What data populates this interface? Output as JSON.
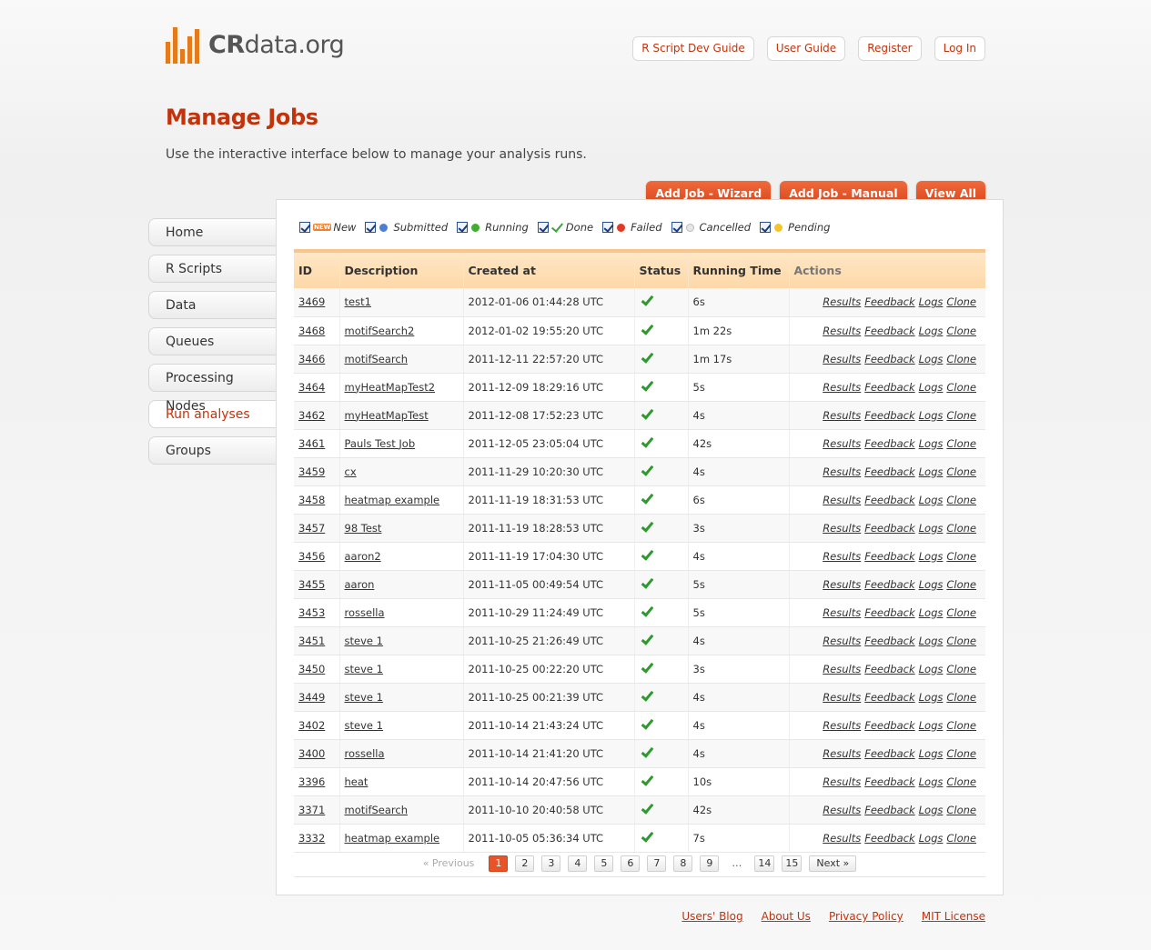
{
  "logo": {
    "brand": "CR",
    "rest": "data.org"
  },
  "topnav": [
    "R Script Dev Guide",
    "User Guide",
    "Register",
    "Log In"
  ],
  "page": {
    "title": "Manage Jobs",
    "subtitle": "Use the interactive interface below to manage your analysis runs."
  },
  "action_buttons": [
    "Add Job - Wizard",
    "Add Job - Manual",
    "View All"
  ],
  "sidebar": [
    {
      "label": "Home",
      "active": false
    },
    {
      "label": "R Scripts",
      "active": false
    },
    {
      "label": "Data",
      "active": false
    },
    {
      "label": "Queues",
      "active": false
    },
    {
      "label": "Processing Nodes",
      "active": false
    },
    {
      "label": "Run analyses",
      "active": true
    },
    {
      "label": "Groups",
      "active": false
    }
  ],
  "legend": [
    {
      "label": "New",
      "icon": "new-badge-icon",
      "color": "#f08030"
    },
    {
      "label": "Submitted",
      "icon": "blue-dot-icon",
      "color": "#4d7fd0"
    },
    {
      "label": "Running",
      "icon": "green-dot-icon",
      "color": "#3fae2f"
    },
    {
      "label": "Done",
      "icon": "green-check-icon",
      "color": "#3aa33a"
    },
    {
      "label": "Failed",
      "icon": "red-dot-icon",
      "color": "#e23a22"
    },
    {
      "label": "Cancelled",
      "icon": "grey-dot-icon",
      "color": "#e6e6e6"
    },
    {
      "label": "Pending",
      "icon": "yellow-dot-icon",
      "color": "#f4c52a"
    }
  ],
  "table": {
    "headers": [
      "ID",
      "Description",
      "Created at",
      "Status",
      "Running Time",
      "Actions"
    ],
    "action_links": [
      "Results",
      "Feedback",
      "Logs",
      "Clone"
    ],
    "rows": [
      {
        "id": "3469",
        "desc": "test1",
        "created": "2012-01-06 01:44:28 UTC",
        "status": "done",
        "time": "6s"
      },
      {
        "id": "3468",
        "desc": "motifSearch2",
        "created": "2012-01-02 19:55:20 UTC",
        "status": "done",
        "time": "1m 22s"
      },
      {
        "id": "3466",
        "desc": "motifSearch",
        "created": "2011-12-11 22:57:20 UTC",
        "status": "done",
        "time": "1m 17s"
      },
      {
        "id": "3464",
        "desc": "myHeatMapTest2",
        "created": "2011-12-09 18:29:16 UTC",
        "status": "done",
        "time": "5s"
      },
      {
        "id": "3462",
        "desc": "myHeatMapTest",
        "created": "2011-12-08 17:52:23 UTC",
        "status": "done",
        "time": "4s"
      },
      {
        "id": "3461",
        "desc": "Pauls Test Job",
        "created": "2011-12-05 23:05:04 UTC",
        "status": "done",
        "time": "42s"
      },
      {
        "id": "3459",
        "desc": "cx",
        "created": "2011-11-29 10:20:30 UTC",
        "status": "done",
        "time": "4s"
      },
      {
        "id": "3458",
        "desc": "heatmap example",
        "created": "2011-11-19 18:31:53 UTC",
        "status": "done",
        "time": "6s"
      },
      {
        "id": "3457",
        "desc": "98 Test",
        "created": "2011-11-19 18:28:53 UTC",
        "status": "done",
        "time": "3s"
      },
      {
        "id": "3456",
        "desc": "aaron2",
        "created": "2011-11-19 17:04:30 UTC",
        "status": "done",
        "time": "4s"
      },
      {
        "id": "3455",
        "desc": "aaron",
        "created": "2011-11-05 00:49:54 UTC",
        "status": "done",
        "time": "5s"
      },
      {
        "id": "3453",
        "desc": "rossella",
        "created": "2011-10-29 11:24:49 UTC",
        "status": "done",
        "time": "5s"
      },
      {
        "id": "3451",
        "desc": "steve 1",
        "created": "2011-10-25 21:26:49 UTC",
        "status": "done",
        "time": "4s"
      },
      {
        "id": "3450",
        "desc": "steve 1",
        "created": "2011-10-25 00:22:20 UTC",
        "status": "done",
        "time": "3s"
      },
      {
        "id": "3449",
        "desc": "steve 1",
        "created": "2011-10-25 00:21:39 UTC",
        "status": "done",
        "time": "4s"
      },
      {
        "id": "3402",
        "desc": "steve 1",
        "created": "2011-10-14 21:43:24 UTC",
        "status": "done",
        "time": "4s"
      },
      {
        "id": "3400",
        "desc": "rossella",
        "created": "2011-10-14 21:41:20 UTC",
        "status": "done",
        "time": "4s"
      },
      {
        "id": "3396",
        "desc": "heat",
        "created": "2011-10-14 20:47:56 UTC",
        "status": "done",
        "time": "10s"
      },
      {
        "id": "3371",
        "desc": "motifSearch",
        "created": "2011-10-10 20:40:58 UTC",
        "status": "done",
        "time": "42s"
      },
      {
        "id": "3332",
        "desc": "heatmap example",
        "created": "2011-10-05 05:36:34 UTC",
        "status": "done",
        "time": "7s"
      }
    ]
  },
  "pagination": {
    "previous": "« Previous",
    "pages": [
      "1",
      "2",
      "3",
      "4",
      "5",
      "6",
      "7",
      "8",
      "9"
    ],
    "ellipsis": "…",
    "tail_pages": [
      "14",
      "15"
    ],
    "current": "1",
    "next": "Next »"
  },
  "footer": [
    "Users' Blog",
    "About Us",
    "Privacy Policy",
    "MIT License"
  ]
}
